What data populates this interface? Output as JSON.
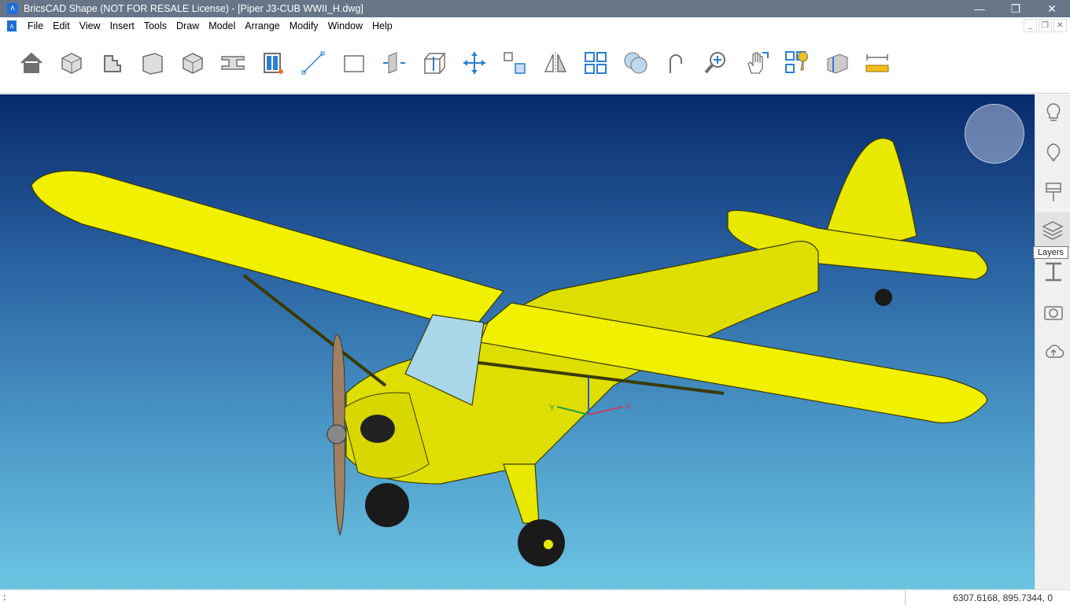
{
  "titlebar": {
    "title": "BricsCAD Shape (NOT FOR RESALE License) - [Piper J3-CUB WWII_H.dwg]",
    "minimize": "—",
    "restore": "❐",
    "close": "✕"
  },
  "menubar": {
    "items": [
      "File",
      "Edit",
      "View",
      "Insert",
      "Tools",
      "Draw",
      "Model",
      "Arrange",
      "Modify",
      "Window",
      "Help"
    ],
    "doc_minimize": "_",
    "doc_restore": "❐",
    "doc_close": "✕"
  },
  "toolbar": {
    "icons": [
      "home-icon",
      "solid-brick-icon",
      "stairs-icon",
      "wall-icon",
      "box-icon",
      "beam-icon",
      "window-icon",
      "line-icon",
      "rectangle-icon",
      "push-pull-icon",
      "extrude-box-icon",
      "move-icon",
      "copy-icon",
      "mirror-icon",
      "array-icon",
      "union-icon",
      "rotate-icon",
      "zoom-icon",
      "pan-icon",
      "visual-style-icon",
      "section-icon",
      "measure-icon"
    ]
  },
  "rightpanel": {
    "icons": [
      "lightbulb-icon",
      "balloon-icon",
      "brush-icon",
      "layers-icon",
      "beam-profile-icon",
      "camera-icon",
      "cloud-upload-icon"
    ],
    "tooltip": "Layers"
  },
  "viewport": {
    "ucs_x": "X",
    "ucs_y": "Y",
    "colors": {
      "plane": "#e8e800",
      "outline": "#3a3a00"
    }
  },
  "statusbar": {
    "left": ":",
    "coords": "6307.6168, 895.7344, 0"
  }
}
